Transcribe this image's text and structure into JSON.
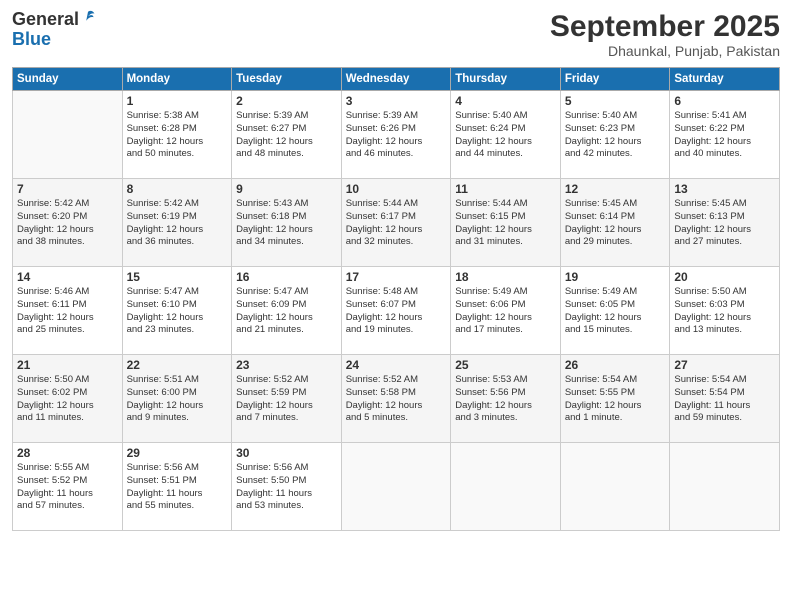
{
  "header": {
    "logo_line1": "General",
    "logo_line2": "Blue",
    "month_title": "September 2025",
    "location": "Dhaunkal, Punjab, Pakistan"
  },
  "weekdays": [
    "Sunday",
    "Monday",
    "Tuesday",
    "Wednesday",
    "Thursday",
    "Friday",
    "Saturday"
  ],
  "weeks": [
    [
      {
        "day": "",
        "info": ""
      },
      {
        "day": "1",
        "info": "Sunrise: 5:38 AM\nSunset: 6:28 PM\nDaylight: 12 hours\nand 50 minutes."
      },
      {
        "day": "2",
        "info": "Sunrise: 5:39 AM\nSunset: 6:27 PM\nDaylight: 12 hours\nand 48 minutes."
      },
      {
        "day": "3",
        "info": "Sunrise: 5:39 AM\nSunset: 6:26 PM\nDaylight: 12 hours\nand 46 minutes."
      },
      {
        "day": "4",
        "info": "Sunrise: 5:40 AM\nSunset: 6:24 PM\nDaylight: 12 hours\nand 44 minutes."
      },
      {
        "day": "5",
        "info": "Sunrise: 5:40 AM\nSunset: 6:23 PM\nDaylight: 12 hours\nand 42 minutes."
      },
      {
        "day": "6",
        "info": "Sunrise: 5:41 AM\nSunset: 6:22 PM\nDaylight: 12 hours\nand 40 minutes."
      }
    ],
    [
      {
        "day": "7",
        "info": "Sunrise: 5:42 AM\nSunset: 6:20 PM\nDaylight: 12 hours\nand 38 minutes."
      },
      {
        "day": "8",
        "info": "Sunrise: 5:42 AM\nSunset: 6:19 PM\nDaylight: 12 hours\nand 36 minutes."
      },
      {
        "day": "9",
        "info": "Sunrise: 5:43 AM\nSunset: 6:18 PM\nDaylight: 12 hours\nand 34 minutes."
      },
      {
        "day": "10",
        "info": "Sunrise: 5:44 AM\nSunset: 6:17 PM\nDaylight: 12 hours\nand 32 minutes."
      },
      {
        "day": "11",
        "info": "Sunrise: 5:44 AM\nSunset: 6:15 PM\nDaylight: 12 hours\nand 31 minutes."
      },
      {
        "day": "12",
        "info": "Sunrise: 5:45 AM\nSunset: 6:14 PM\nDaylight: 12 hours\nand 29 minutes."
      },
      {
        "day": "13",
        "info": "Sunrise: 5:45 AM\nSunset: 6:13 PM\nDaylight: 12 hours\nand 27 minutes."
      }
    ],
    [
      {
        "day": "14",
        "info": "Sunrise: 5:46 AM\nSunset: 6:11 PM\nDaylight: 12 hours\nand 25 minutes."
      },
      {
        "day": "15",
        "info": "Sunrise: 5:47 AM\nSunset: 6:10 PM\nDaylight: 12 hours\nand 23 minutes."
      },
      {
        "day": "16",
        "info": "Sunrise: 5:47 AM\nSunset: 6:09 PM\nDaylight: 12 hours\nand 21 minutes."
      },
      {
        "day": "17",
        "info": "Sunrise: 5:48 AM\nSunset: 6:07 PM\nDaylight: 12 hours\nand 19 minutes."
      },
      {
        "day": "18",
        "info": "Sunrise: 5:49 AM\nSunset: 6:06 PM\nDaylight: 12 hours\nand 17 minutes."
      },
      {
        "day": "19",
        "info": "Sunrise: 5:49 AM\nSunset: 6:05 PM\nDaylight: 12 hours\nand 15 minutes."
      },
      {
        "day": "20",
        "info": "Sunrise: 5:50 AM\nSunset: 6:03 PM\nDaylight: 12 hours\nand 13 minutes."
      }
    ],
    [
      {
        "day": "21",
        "info": "Sunrise: 5:50 AM\nSunset: 6:02 PM\nDaylight: 12 hours\nand 11 minutes."
      },
      {
        "day": "22",
        "info": "Sunrise: 5:51 AM\nSunset: 6:00 PM\nDaylight: 12 hours\nand 9 minutes."
      },
      {
        "day": "23",
        "info": "Sunrise: 5:52 AM\nSunset: 5:59 PM\nDaylight: 12 hours\nand 7 minutes."
      },
      {
        "day": "24",
        "info": "Sunrise: 5:52 AM\nSunset: 5:58 PM\nDaylight: 12 hours\nand 5 minutes."
      },
      {
        "day": "25",
        "info": "Sunrise: 5:53 AM\nSunset: 5:56 PM\nDaylight: 12 hours\nand 3 minutes."
      },
      {
        "day": "26",
        "info": "Sunrise: 5:54 AM\nSunset: 5:55 PM\nDaylight: 12 hours\nand 1 minute."
      },
      {
        "day": "27",
        "info": "Sunrise: 5:54 AM\nSunset: 5:54 PM\nDaylight: 11 hours\nand 59 minutes."
      }
    ],
    [
      {
        "day": "28",
        "info": "Sunrise: 5:55 AM\nSunset: 5:52 PM\nDaylight: 11 hours\nand 57 minutes."
      },
      {
        "day": "29",
        "info": "Sunrise: 5:56 AM\nSunset: 5:51 PM\nDaylight: 11 hours\nand 55 minutes."
      },
      {
        "day": "30",
        "info": "Sunrise: 5:56 AM\nSunset: 5:50 PM\nDaylight: 11 hours\nand 53 minutes."
      },
      {
        "day": "",
        "info": ""
      },
      {
        "day": "",
        "info": ""
      },
      {
        "day": "",
        "info": ""
      },
      {
        "day": "",
        "info": ""
      }
    ]
  ]
}
